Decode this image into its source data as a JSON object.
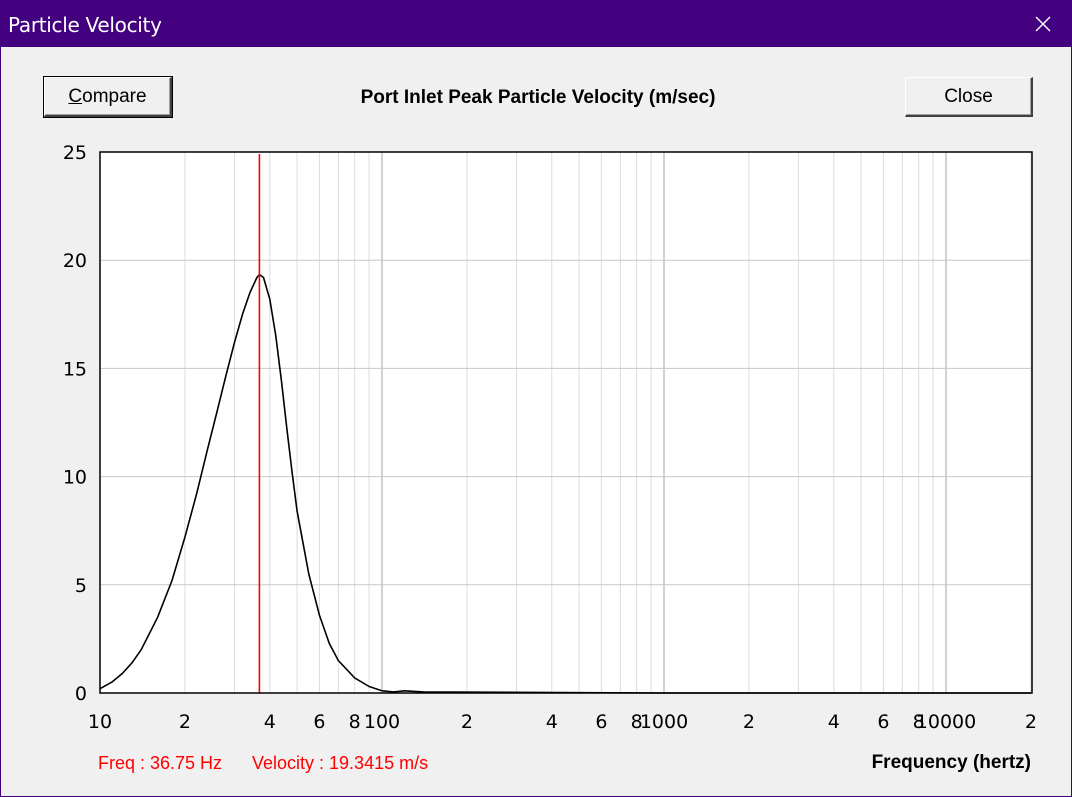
{
  "window": {
    "title": "Particle Velocity"
  },
  "toolbar": {
    "compare_label": "Compare",
    "close_label": "Close"
  },
  "chart_data": {
    "type": "line",
    "title": "Port Inlet Peak Particle Velocity (m/sec)",
    "xlabel": "Frequency (hertz)",
    "ylabel": "",
    "xscale": "log",
    "xlim": [
      10,
      20000
    ],
    "ylim": [
      0,
      25
    ],
    "yticks": [
      0,
      5,
      10,
      15,
      20,
      25
    ],
    "xticks": [
      {
        "value": 10,
        "label": "10"
      },
      {
        "value": 20,
        "label": "2"
      },
      {
        "value": 40,
        "label": "4"
      },
      {
        "value": 60,
        "label": "6"
      },
      {
        "value": 80,
        "label": "8"
      },
      {
        "value": 100,
        "label": "100"
      },
      {
        "value": 200,
        "label": "2"
      },
      {
        "value": 400,
        "label": "4"
      },
      {
        "value": 600,
        "label": "6"
      },
      {
        "value": 800,
        "label": "8"
      },
      {
        "value": 1000,
        "label": "1000"
      },
      {
        "value": 2000,
        "label": "2"
      },
      {
        "value": 4000,
        "label": "4"
      },
      {
        "value": 6000,
        "label": "6"
      },
      {
        "value": 8000,
        "label": "8"
      },
      {
        "value": 10000,
        "label": "10000"
      },
      {
        "value": 20000,
        "label": "2"
      }
    ],
    "grid": true,
    "series": [
      {
        "color": "#000000",
        "x": [
          10,
          11,
          12,
          13,
          14,
          16,
          18,
          20,
          22,
          24,
          26,
          28,
          30,
          32,
          34,
          36,
          36.75,
          38,
          40,
          42,
          44,
          46,
          48,
          50,
          55,
          60,
          65,
          70,
          80,
          90,
          100,
          110,
          120,
          140,
          1000,
          20000
        ],
        "y": [
          0.2,
          0.5,
          0.9,
          1.4,
          2.0,
          3.5,
          5.2,
          7.2,
          9.2,
          11.2,
          13.0,
          14.7,
          16.2,
          17.5,
          18.5,
          19.2,
          19.34,
          19.2,
          18.2,
          16.5,
          14.4,
          12.2,
          10.2,
          8.4,
          5.5,
          3.6,
          2.3,
          1.5,
          0.7,
          0.3,
          0.1,
          0.05,
          0.1,
          0.05,
          0,
          0
        ]
      }
    ],
    "cursor": {
      "x": 36.75,
      "color": "#ff0000"
    },
    "readout": {
      "freq": "Freq : 36.75 Hz",
      "velocity": "Velocity : 19.3415 m/s"
    }
  }
}
